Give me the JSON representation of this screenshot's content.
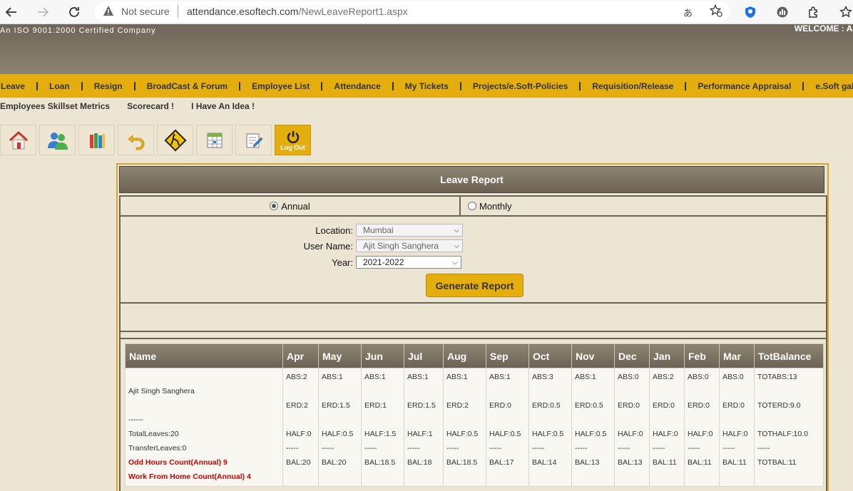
{
  "browser": {
    "not_secure": "Not secure",
    "url_host": "attendance.esoftech.com",
    "url_path": "/NewLeaveReport1.aspx"
  },
  "header": {
    "iso": "An ISO 9001:2000 Certified Company",
    "welcome": "WELCOME : AJ"
  },
  "menu": [
    "Leave",
    "Loan",
    "Resign",
    "BroadCast & Forum",
    "Employee List",
    "Attendance",
    "My Tickets",
    "Projects/e.Soft-Policies",
    "Requisition/Release",
    "Performance Appraisal",
    "e.Soft gallery"
  ],
  "submenu": [
    "Employees Skillset Metrics",
    "Scorecard !",
    "I Have An Idea !"
  ],
  "toolbar": {
    "logout_label": "Log Out",
    "icons": [
      "home-icon",
      "users-icon",
      "books-icon",
      "undo-icon",
      "warning-icon",
      "calendar-icon",
      "edit-icon",
      "power-icon"
    ]
  },
  "report": {
    "title": "Leave Report",
    "annual_label": "Annual",
    "monthly_label": "Monthly",
    "location_label": "Location:",
    "location_value": "Mumbai",
    "username_label": "User Name:",
    "username_value": "Ajit Singh Sanghera",
    "year_label": "Year:",
    "year_value": "2021-2022",
    "generate_label": "Generate Report"
  },
  "table": {
    "headers": [
      "Name",
      "Apr",
      "May",
      "Jun",
      "Jul",
      "Aug",
      "Sep",
      "Oct",
      "Nov",
      "Dec",
      "Jan",
      "Feb",
      "Mar",
      "TotBalance"
    ],
    "name_cell": {
      "name": "Ajit Singh Sanghera",
      "dashes": "------",
      "total_leaves": "TotalLeaves:20",
      "transfer_leaves": "TransferLeaves:0",
      "odd_hours": "Odd Hours Count(Annual) 9",
      "wfh": "Work From Home Count(Annual) 4"
    },
    "months": [
      {
        "abs": "ABS:2",
        "erd": "ERD:2",
        "half": "HALF:0",
        "dash": "-----",
        "bal": "BAL:20"
      },
      {
        "abs": "ABS:1",
        "erd": "ERD:1.5",
        "half": "HALF:0.5",
        "dash": "-----",
        "bal": "BAL:20"
      },
      {
        "abs": "ABS:1",
        "erd": "ERD:1",
        "half": "HALF:1.5",
        "dash": "-----",
        "bal": "BAL:18.5"
      },
      {
        "abs": "ABS:1",
        "erd": "ERD:1.5",
        "half": "HALF:1",
        "dash": "-----",
        "bal": "BAL:18"
      },
      {
        "abs": "ABS:1",
        "erd": "ERD:2",
        "half": "HALF:0.5",
        "dash": "-----",
        "bal": "BAL:18.5"
      },
      {
        "abs": "ABS:1",
        "erd": "ERD:0",
        "half": "HALF:0.5",
        "dash": "-----",
        "bal": "BAL:17"
      },
      {
        "abs": "ABS:3",
        "erd": "ERD:0.5",
        "half": "HALF:0.5",
        "dash": "-----",
        "bal": "BAL:14"
      },
      {
        "abs": "ABS:1",
        "erd": "ERD:0.5",
        "half": "HALF:0.5",
        "dash": "-----",
        "bal": "BAL:13"
      },
      {
        "abs": "ABS:0",
        "erd": "ERD:0",
        "half": "HALF:0",
        "dash": "-----",
        "bal": "BAL:13"
      },
      {
        "abs": "ABS:2",
        "erd": "ERD:0",
        "half": "HALF:0",
        "dash": "-----",
        "bal": "BAL:11"
      },
      {
        "abs": "ABS:0",
        "erd": "ERD:0",
        "half": "HALF:0",
        "dash": "-----",
        "bal": "BAL:11"
      },
      {
        "abs": "ABS:0",
        "erd": "ERD:0",
        "half": "HALF:0",
        "dash": "-----",
        "bal": "BAL:11"
      }
    ],
    "total": {
      "abs": "TOTABS:13",
      "erd": "TOTERD:9.0",
      "half": "TOTHALF:10.0",
      "dash": "-----",
      "bal": "TOTBAL:11"
    }
  }
}
